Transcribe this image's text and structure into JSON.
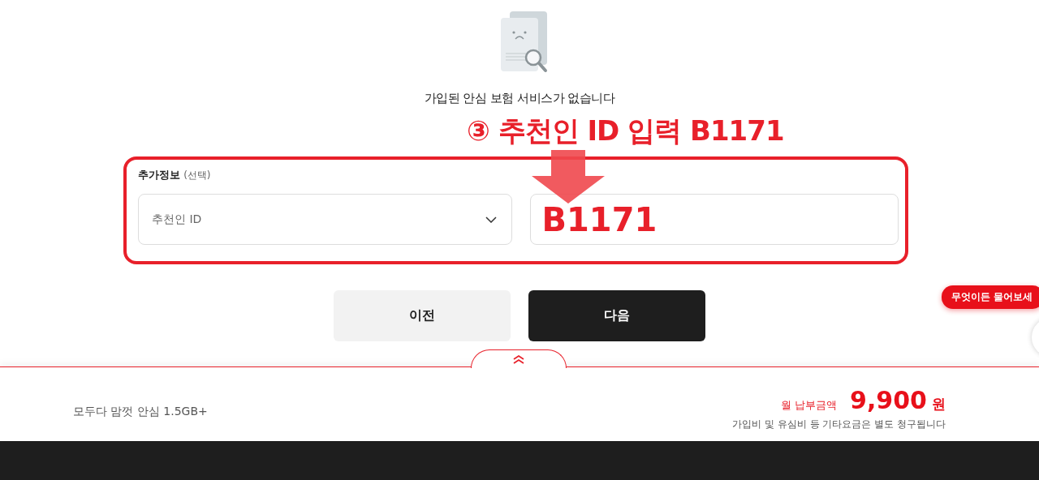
{
  "empty_state": {
    "message": "가입된 안심 보험 서비스가 없습니다"
  },
  "annotation": {
    "label": "③ 추천인 ID 입력 B1171"
  },
  "additional_info": {
    "title": "추가정보",
    "optional": "(선택)",
    "select": {
      "value": "추천인 ID"
    },
    "input": {
      "value": "B1171"
    }
  },
  "buttons": [
    {
      "label": "이전",
      "kind": "secondary"
    },
    {
      "label": "다음",
      "kind": "primary"
    }
  ],
  "chat_bubble": {
    "text": "무엇이든 물어보세"
  },
  "summary": {
    "plan": "모두다 맘껏 안심 1.5GB+",
    "price_label": "월 납부금액",
    "price": "9,900",
    "unit": "원",
    "note": "가입비 및 유심비 등 기타요금은 별도 청구됩니다"
  }
}
